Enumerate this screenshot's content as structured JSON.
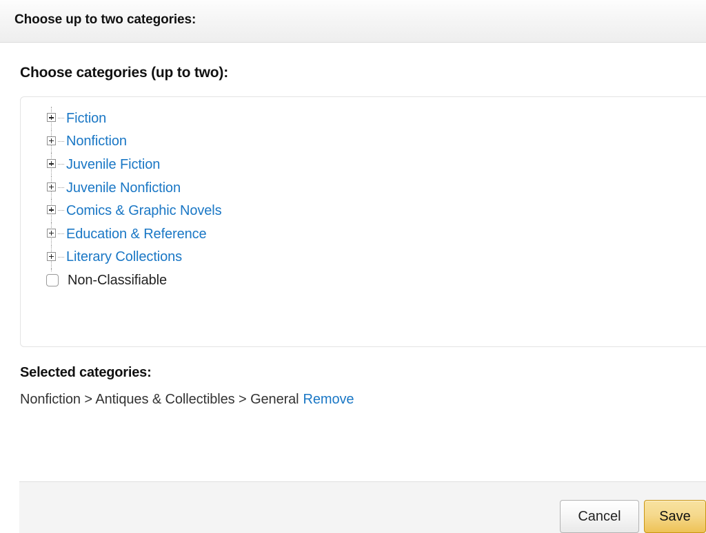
{
  "titlebar": {
    "title": "Choose up to two categories:"
  },
  "main": {
    "section_heading": "Choose categories (up to two):",
    "tree": {
      "nodes": [
        {
          "label": "Fiction",
          "type": "expandable",
          "icon": "plus-box-icon",
          "expanded": false
        },
        {
          "label": "Nonfiction",
          "type": "expandable",
          "icon": "plus-box-icon",
          "expanded": false
        },
        {
          "label": "Juvenile Fiction",
          "type": "expandable",
          "icon": "plus-box-icon",
          "expanded": false
        },
        {
          "label": "Juvenile Nonfiction",
          "type": "expandable",
          "icon": "plus-box-icon",
          "expanded": false
        },
        {
          "label": "Comics & Graphic Novels",
          "type": "expandable",
          "icon": "plus-box-icon",
          "expanded": false
        },
        {
          "label": "Education & Reference",
          "type": "expandable",
          "icon": "plus-box-icon",
          "expanded": false
        },
        {
          "label": "Literary Collections",
          "type": "expandable",
          "icon": "plus-box-icon",
          "expanded": false
        },
        {
          "label": "Non-Classifiable",
          "type": "leaf",
          "icon": "checkbox-icon",
          "checked": false
        }
      ]
    },
    "selected": {
      "heading": "Selected categories:",
      "items": [
        {
          "path": "Nonfiction > Antiques & Collectibles > General",
          "remove_label": "Remove"
        }
      ]
    }
  },
  "footer": {
    "cancel_label": "Cancel",
    "save_label": "Save"
  },
  "colors": {
    "link_blue": "#1a77c5",
    "save_gold": "#eec256",
    "save_border": "#c89411",
    "header_bg": "#f4f4f4",
    "text_dark": "#111111"
  }
}
